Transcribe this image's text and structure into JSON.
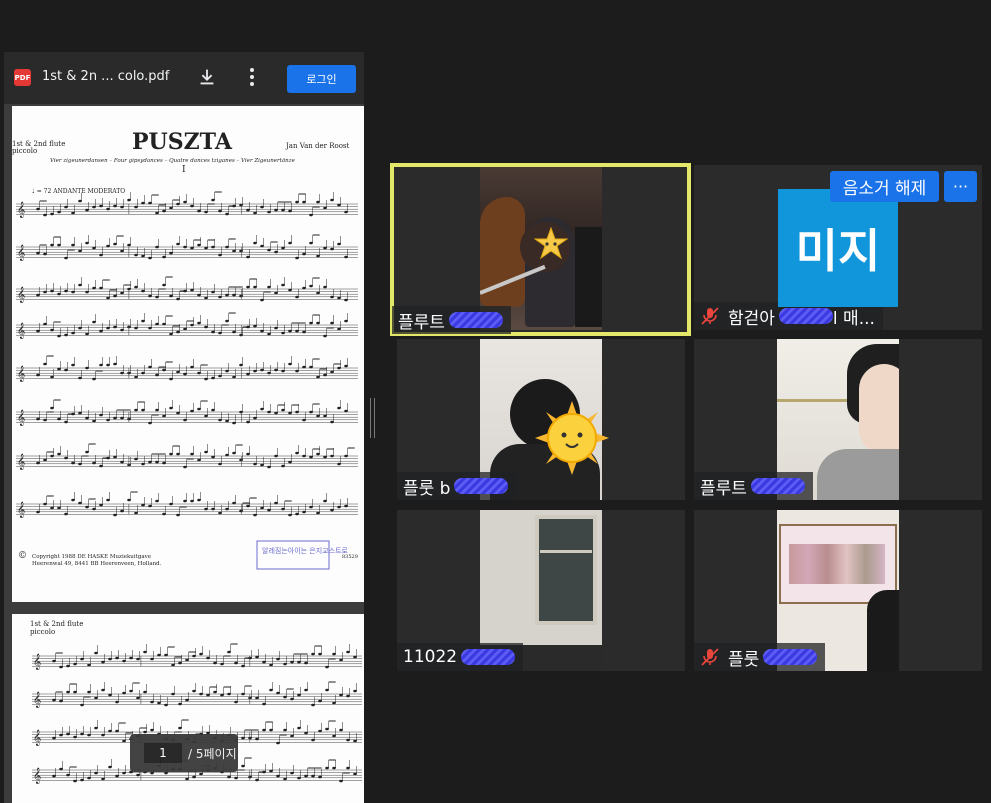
{
  "pdf": {
    "icon_text": "PDF",
    "filename": "1st & 2n ... colo.pdf",
    "login_label": "로그인",
    "page_current": "1",
    "page_total": "/ 5페이지",
    "page1": {
      "part_label": "1st & 2nd flute",
      "part_sub": "piccolo",
      "title": "PUSZTA",
      "composer": "Jan Van der Roost",
      "subtitle": "Vier zigeunerdansen – Four gipsydances – Quatre dances tziganes – Vier Zigeunertänze",
      "movement": "I",
      "tempo": "♩ = 72 ANDANTE MODERATO",
      "copyright": "Copyright 1988  DE HASKE Muziekuitgave",
      "address": "Heerenwal 49, 8441 BB  Heerenveen, Holland.",
      "stamp": "알레짐는아이는 은지교스트로",
      "code": "83529"
    },
    "page2": {
      "part_label": "1st & 2nd flute",
      "part_sub": "piccolo"
    }
  },
  "meeting": {
    "tiles": [
      {
        "name": "플루트",
        "muted": false,
        "active": true
      },
      {
        "name": "함걷아",
        "suffix": "l 매...",
        "muted": true,
        "active": false
      },
      {
        "name": "플룻 b",
        "muted": false,
        "active": false
      },
      {
        "name": "플루트",
        "muted": false,
        "active": false
      },
      {
        "name": "11022",
        "muted": false,
        "active": false
      },
      {
        "name": "플룻",
        "muted": true,
        "active": false
      }
    ],
    "unmute_label": "음소거 해제",
    "more_label": "···",
    "avatar_text": "미지"
  },
  "icons": [
    "pdf-icon",
    "download-icon",
    "more-vert-icon",
    "mic-off-icon",
    "sun-sticker-icon",
    "star-sticker-icon"
  ],
  "colors": {
    "accent": "#1a73e8",
    "active_border": "#e3e86a",
    "mic_off": "#e8453c",
    "background": "#1c1c1c"
  }
}
